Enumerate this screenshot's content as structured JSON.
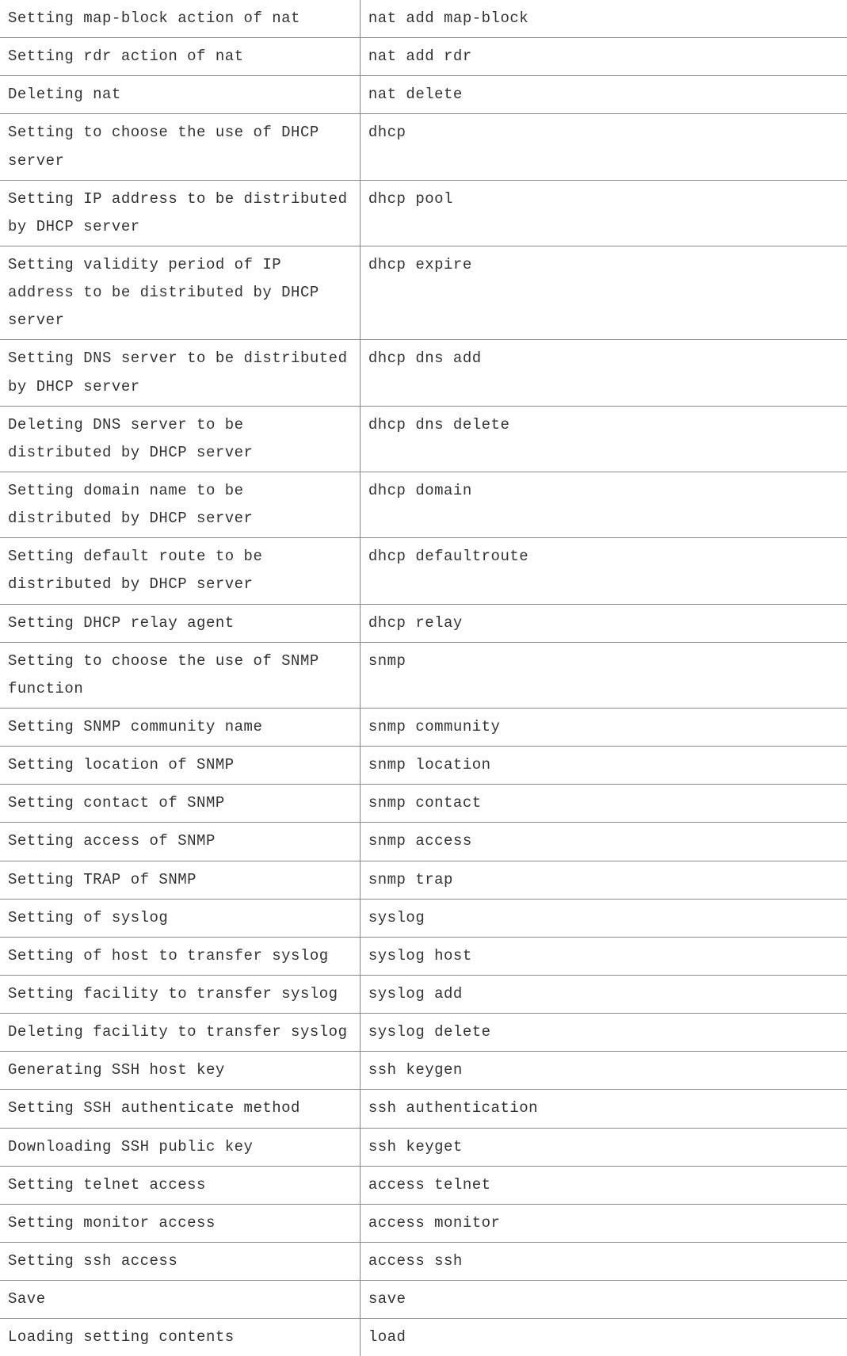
{
  "rows": [
    {
      "description": "Setting map-block action of nat",
      "command": "nat add map-block"
    },
    {
      "description": "Setting rdr action of nat",
      "command": "nat add rdr"
    },
    {
      "description": "Deleting nat",
      "command": "nat delete"
    },
    {
      "description": "Setting to choose the use of DHCP server",
      "command": "dhcp"
    },
    {
      "description": "Setting IP address to be distributed by DHCP server",
      "command": "dhcp pool"
    },
    {
      "description": "Setting validity period of IP address to be distributed by DHCP server",
      "command": "dhcp expire"
    },
    {
      "description": "Setting DNS server to be distributed by DHCP server",
      "command": "dhcp dns add"
    },
    {
      "description": "Deleting DNS server to be distributed by DHCP server",
      "command": "dhcp dns delete"
    },
    {
      "description": "Setting domain name to be distributed by DHCP server",
      "command": "dhcp domain"
    },
    {
      "description": "Setting default route to be distributed by DHCP server",
      "command": "dhcp defaultroute"
    },
    {
      "description": "Setting DHCP relay agent",
      "command": "dhcp relay"
    },
    {
      "description": "Setting to choose the use of SNMP function",
      "command": "snmp"
    },
    {
      "description": "Setting SNMP community name",
      "command": "snmp community"
    },
    {
      "description": "Setting location of SNMP",
      "command": "snmp location"
    },
    {
      "description": "Setting contact of SNMP",
      "command": "snmp contact"
    },
    {
      "description": "Setting access of SNMP",
      "command": "snmp access"
    },
    {
      "description": "Setting TRAP of SNMP",
      "command": "snmp trap"
    },
    {
      "description": "Setting of syslog",
      "command": "syslog"
    },
    {
      "description": "Setting of host to transfer syslog",
      "command": "syslog host"
    },
    {
      "description": "Setting facility to transfer syslog",
      "command": "syslog add"
    },
    {
      "description": "Deleting facility to transfer syslog",
      "command": "syslog delete"
    },
    {
      "description": "Generating SSH host key",
      "command": "ssh keygen"
    },
    {
      "description": "Setting SSH authenticate method",
      "command": "ssh authentication"
    },
    {
      "description": "Downloading SSH public key",
      "command": "ssh keyget"
    },
    {
      "description": "Setting telnet access",
      "command": "access telnet"
    },
    {
      "description": "Setting monitor access",
      "command": "access monitor"
    },
    {
      "description": "Setting ssh access",
      "command": "access ssh"
    },
    {
      "description": "Save",
      "command": "save"
    },
    {
      "description": "Loading setting contents",
      "command": "load"
    }
  ]
}
